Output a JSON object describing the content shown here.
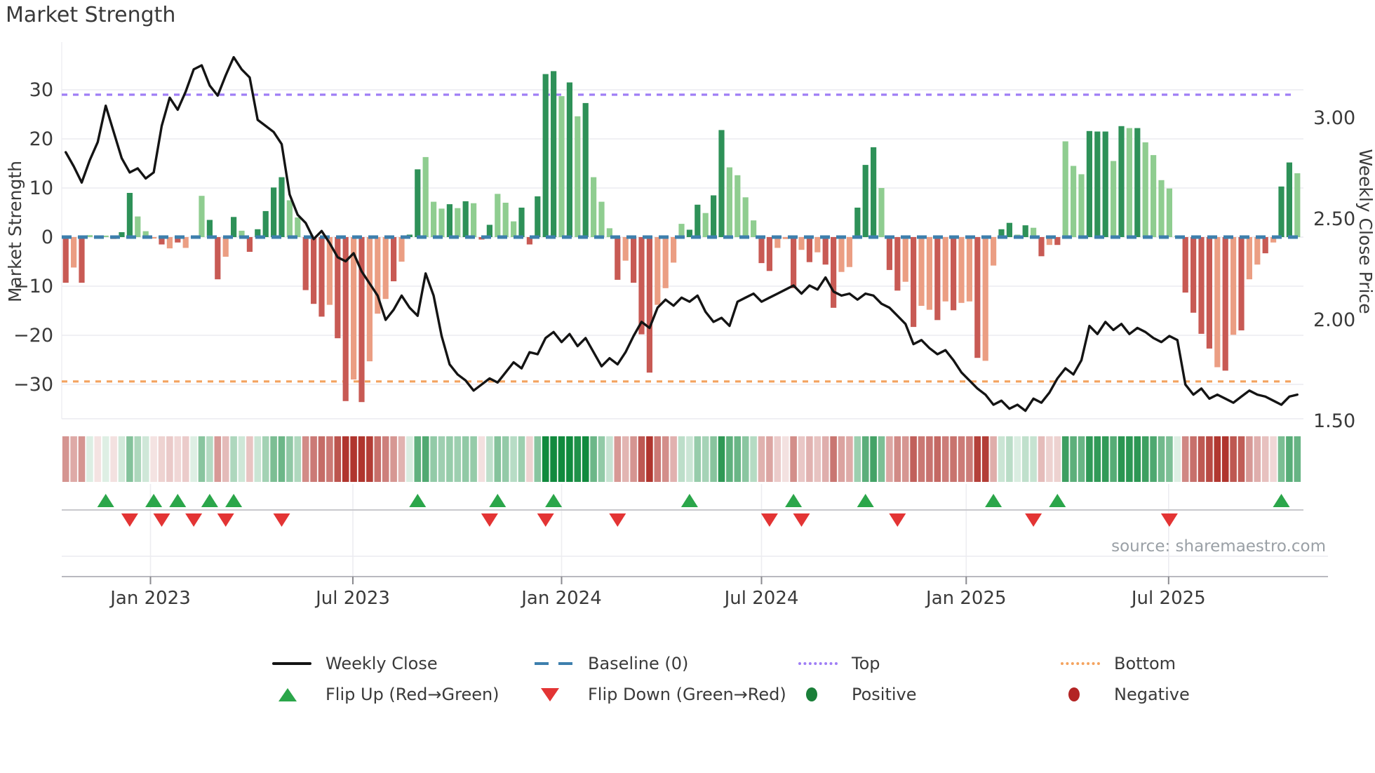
{
  "title": "Market Strength",
  "source_note": "source: sharemaestro.com",
  "colors": {
    "bar_pos_dark": "#2e9158",
    "bar_pos_light": "#8fcd90",
    "bar_neg_dark": "#c85a54",
    "bar_neg_light": "#eb9e83",
    "weekly_close_line": "#141414",
    "baseline_dash": "#3d7fad",
    "top_line": "#9f7ef5",
    "bottom_line": "#f4a35f",
    "flip_up": "#2ba64a",
    "flip_down": "#e33434",
    "positive_dot": "#1a7f39",
    "negative_dot": "#b32424",
    "grid": "#ebebf0",
    "axis_line": "#b9b9bf",
    "tick_text": "#3a3a3a",
    "source_text": "#9aa0a6",
    "heat_green_max": "#118a3e",
    "heat_red_max": "#b0352e"
  },
  "legend": {
    "rows": [
      {
        "items": [
          {
            "label": "Weekly Close"
          },
          {
            "label": "Baseline (0)"
          },
          {
            "label": "Top"
          },
          {
            "label": "Bottom"
          }
        ]
      },
      {
        "items": [
          {
            "label": "Flip Up (Red→Green)"
          },
          {
            "label": "Flip Down (Green→Red)"
          },
          {
            "label": "Positive"
          },
          {
            "label": "Negative"
          }
        ]
      }
    ]
  },
  "chart_data": {
    "type": "combo-bar-line",
    "title": "Market Strength",
    "ylabel_left": "Market Strength",
    "ylabel_right": "Weekly Close Price",
    "y_left_ticks": [
      "30",
      "20",
      "10",
      "0",
      "−10",
      "−20",
      "−30"
    ],
    "y_left_tick_values": [
      30,
      20,
      10,
      0,
      -10,
      -20,
      -30
    ],
    "y_left_range": [
      -40,
      40
    ],
    "y_right_ticks": [
      "3.00",
      "2.50",
      "2.00",
      "1.50"
    ],
    "y_right_tick_values": [
      3.0,
      2.5,
      2.0,
      1.5
    ],
    "x_tick_labels": [
      "Jan 2023",
      "Jul 2023",
      "Jan 2024",
      "Jul 2024",
      "Jan 2025",
      "Jul 2025"
    ],
    "x_tick_weeks": [
      10.6,
      35.9,
      62.0,
      87.0,
      112.6,
      137.9
    ],
    "top_level": 29,
    "bottom_level": -29.4,
    "baseline_level": 0,
    "grid": true,
    "legend_position": "bottom",
    "series": [
      {
        "name": "Market Strength (weekly bars)",
        "type": "bar",
        "values": [
          -9.3,
          -6.2,
          -9.3,
          0.4,
          -0.3,
          0.3,
          -0.4,
          1.0,
          9.0,
          4.2,
          1.2,
          -0.3,
          -1.5,
          -2.3,
          -1.1,
          -2.2,
          0.3,
          8.4,
          3.5,
          -8.6,
          -4.0,
          4.1,
          1.3,
          -3.0,
          1.6,
          5.3,
          10.1,
          12.2,
          7.5,
          4.0,
          -10.8,
          -13.6,
          -16.2,
          -13.8,
          -20.6,
          -33.4,
          -29.0,
          -33.6,
          -25.3,
          -15.6,
          -12.6,
          -9.0,
          -5.0,
          0.5,
          13.8,
          16.3,
          7.2,
          5.8,
          6.7,
          5.9,
          7.3,
          6.9,
          -0.5,
          2.5,
          8.8,
          7.0,
          3.2,
          6.0,
          -1.5,
          8.3,
          33.2,
          33.8,
          28.7,
          31.5,
          24.6,
          27.3,
          12.2,
          7.2,
          1.8,
          -8.7,
          -4.8,
          -9.3,
          -19.8,
          -27.6,
          -13.8,
          -10.4,
          -5.2,
          2.7,
          1.5,
          6.6,
          4.9,
          8.5,
          21.8,
          14.2,
          12.6,
          8.1,
          3.4,
          -5.3,
          -6.9,
          -2.2,
          -0.4,
          -10.4,
          -2.6,
          -5.1,
          -3.1,
          -5.6,
          -14.4,
          -7.1,
          -6.1,
          6.0,
          14.7,
          18.3,
          10.0,
          -6.7,
          -10.9,
          -9.1,
          -18.3,
          -14.0,
          -14.8,
          -16.9,
          -13.1,
          -14.9,
          -13.4,
          -13.1,
          -24.6,
          -25.2,
          -5.8,
          1.6,
          2.9,
          0.5,
          2.4,
          1.9,
          -3.9,
          -1.6,
          -1.6,
          19.5,
          14.5,
          12.8,
          21.6,
          21.5,
          21.5,
          15.5,
          22.6,
          22.2,
          22.2,
          19.3,
          16.7,
          11.6,
          9.9,
          0.3,
          -11.3,
          -15.4,
          -19.7,
          -22.7,
          -26.5,
          -27.2,
          -19.9,
          -19.0,
          -8.6,
          -5.6,
          -3.3,
          -1.1,
          10.3,
          15.2,
          13.0
        ],
        "shades": "dldllllddl lldldldldd ldldddddll dddlddldll ldlddllldl dlddllldd d ddldldllld ldddlllldd lddllllddl ldldlddlld ddlddldlld ldlldllddl dldldllldd dldldlllll ddddldldll dlddl"
      },
      {
        "name": "Weekly Close",
        "type": "line",
        "axis": "right",
        "values": [
          2.83,
          2.76,
          2.68,
          2.79,
          2.88,
          3.06,
          2.93,
          2.8,
          2.73,
          2.75,
          2.7,
          2.73,
          2.96,
          3.1,
          3.04,
          3.13,
          3.24,
          3.26,
          3.16,
          3.11,
          3.21,
          3.3,
          3.24,
          3.2,
          2.99,
          2.96,
          2.93,
          2.87,
          2.62,
          2.52,
          2.48,
          2.4,
          2.44,
          2.38,
          2.31,
          2.29,
          2.33,
          2.24,
          2.18,
          2.12,
          2.0,
          2.05,
          2.12,
          2.06,
          2.02,
          2.23,
          2.12,
          1.92,
          1.78,
          1.73,
          1.7,
          1.65,
          1.68,
          1.71,
          1.69,
          1.74,
          1.79,
          1.76,
          1.84,
          1.83,
          1.91,
          1.94,
          1.89,
          1.93,
          1.87,
          1.91,
          1.84,
          1.77,
          1.81,
          1.78,
          1.84,
          1.92,
          1.99,
          1.96,
          2.06,
          2.1,
          2.07,
          2.11,
          2.09,
          2.12,
          2.04,
          1.99,
          2.01,
          1.97,
          2.09,
          2.11,
          2.13,
          2.09,
          2.11,
          2.13,
          2.15,
          2.17,
          2.13,
          2.17,
          2.15,
          2.21,
          2.14,
          2.12,
          2.13,
          2.1,
          2.13,
          2.12,
          2.08,
          2.06,
          2.02,
          1.98,
          1.88,
          1.9,
          1.86,
          1.83,
          1.85,
          1.8,
          1.74,
          1.7,
          1.66,
          1.63,
          1.58,
          1.6,
          1.56,
          1.58,
          1.55,
          1.61,
          1.59,
          1.64,
          1.71,
          1.76,
          1.73,
          1.8,
          1.97,
          1.93,
          1.99,
          1.95,
          1.98,
          1.93,
          1.96,
          1.94,
          1.91,
          1.89,
          1.92,
          1.9,
          1.68,
          1.63,
          1.66,
          1.61,
          1.63,
          1.61,
          1.59,
          1.62,
          1.65,
          1.63,
          1.62,
          1.6,
          1.58,
          1.62,
          1.63
        ]
      }
    ],
    "heat_strip": "derived: sign and magnitude of bar values",
    "markers": {
      "flip_up_weeks": [
        5,
        11,
        14,
        18,
        21,
        44,
        54,
        61,
        78,
        91,
        100,
        116,
        124,
        152
      ],
      "flip_down_weeks": [
        8,
        12,
        16,
        20,
        27,
        53,
        60,
        69,
        88,
        92,
        104,
        121,
        138
      ]
    }
  }
}
